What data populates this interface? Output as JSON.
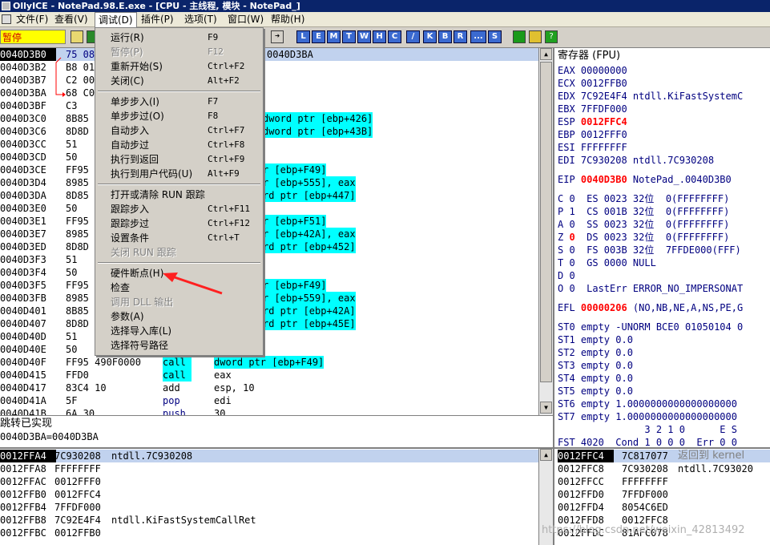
{
  "title": "OllyICE - NotePad.98.E.exe - [CPU - 主线程, 模块 - NotePad_]",
  "menu": [
    "文件(F)",
    "查看(V)",
    "调试(D)",
    "插件(P)",
    "选项(T)",
    "窗口(W)",
    "帮助(H)"
  ],
  "status": "暂停",
  "toolbar_letters": [
    "L",
    "E",
    "M",
    "T",
    "W",
    "H",
    "C",
    "/",
    "K",
    "B",
    "R",
    "...",
    "S"
  ],
  "disasm": {
    "header_addr": "0040D3BA",
    "rows": [
      {
        "addr": "0040D3B0",
        "hex": "75 08",
        "mnem": "",
        "arg": ""
      },
      {
        "addr": "0040D3B2",
        "hex": "B8 01",
        "mnem": "",
        "arg": ""
      },
      {
        "addr": "0040D3B7",
        "hex": "C2 00",
        "mnem": "",
        "arg": ""
      },
      {
        "addr": "0040D3BA",
        "hex": "68 C0",
        "mnem": "",
        "arg": ""
      },
      {
        "addr": "0040D3BF",
        "hex": "C3",
        "mnem": "",
        "arg": ""
      },
      {
        "addr": "0040D3C0",
        "hex": "8B85",
        "mnem": "",
        "arg": "dword ptr [ebp+426]"
      },
      {
        "addr": "0040D3C6",
        "hex": "8D8D",
        "mnem": "",
        "arg": "dword ptr [ebp+43B]"
      },
      {
        "addr": "0040D3CC",
        "hex": "51",
        "mnem": "",
        "arg": ""
      },
      {
        "addr": "0040D3CD",
        "hex": "50",
        "mnem": "",
        "arg": ""
      },
      {
        "addr": "0040D3CE",
        "hex": "FF95",
        "mnem": "",
        "arg": "r [ebp+F49]"
      },
      {
        "addr": "0040D3D4",
        "hex": "8985",
        "mnem": "",
        "arg": "r [ebp+555], eax"
      },
      {
        "addr": "0040D3DA",
        "hex": "8D85",
        "mnem": "",
        "arg": "rd ptr [ebp+447]"
      },
      {
        "addr": "0040D3E0",
        "hex": "50",
        "mnem": "",
        "arg": ""
      },
      {
        "addr": "0040D3E1",
        "hex": "FF95",
        "mnem": "",
        "arg": "r [ebp+F51]"
      },
      {
        "addr": "0040D3E7",
        "hex": "8985",
        "mnem": "",
        "arg": "r [ebp+42A], eax"
      },
      {
        "addr": "0040D3ED",
        "hex": "8D8D",
        "mnem": "",
        "arg": "rd ptr [ebp+452]"
      },
      {
        "addr": "0040D3F3",
        "hex": "51",
        "mnem": "",
        "arg": ""
      },
      {
        "addr": "0040D3F4",
        "hex": "50",
        "mnem": "",
        "arg": ""
      },
      {
        "addr": "0040D3F5",
        "hex": "FF95",
        "mnem": "",
        "arg": "r [ebp+F49]"
      },
      {
        "addr": "0040D3FB",
        "hex": "8985",
        "mnem": "",
        "arg": "r [ebp+559], eax"
      },
      {
        "addr": "0040D401",
        "hex": "8B85",
        "mnem": "",
        "arg": "rd ptr [ebp+42A]"
      },
      {
        "addr": "0040D407",
        "hex": "8D8D",
        "mnem": "",
        "arg": "rd ptr [ebp+45E]"
      },
      {
        "addr": "0040D40D",
        "hex": "51",
        "mnem": "",
        "arg": ""
      },
      {
        "addr": "0040D40E",
        "hex": "50",
        "mnem": "",
        "arg": ""
      },
      {
        "addr": "0040D40F",
        "hex": "FF95 490F0000",
        "mnem": "call",
        "arg": "dword ptr [ebp+F49]"
      },
      {
        "addr": "0040D415",
        "hex": "FFD0",
        "mnem": "call",
        "arg": "eax"
      },
      {
        "addr": "0040D417",
        "hex": "83C4 10",
        "mnem": "add",
        "arg": "esp, 10"
      },
      {
        "addr": "0040D41A",
        "hex": "5F",
        "mnem": "pop",
        "arg": "edi"
      },
      {
        "addr": "0040D41B",
        "hex": "6A 30",
        "mnem": "push",
        "arg": "30"
      }
    ]
  },
  "info": {
    "line1": "跳转已实现",
    "line2": "0040D3BA=0040D3BA"
  },
  "debug_menu": [
    {
      "label": "运行(R)",
      "shortcut": "F9",
      "disabled": false
    },
    {
      "label": "暂停(P)",
      "shortcut": "F12",
      "disabled": true
    },
    {
      "label": "重新开始(S)",
      "shortcut": "Ctrl+F2",
      "disabled": false
    },
    {
      "label": "关闭(C)",
      "shortcut": "Alt+F2",
      "disabled": false
    },
    {
      "sep": true
    },
    {
      "label": "单步步入(I)",
      "shortcut": "F7",
      "disabled": false
    },
    {
      "label": "单步步过(O)",
      "shortcut": "F8",
      "disabled": false
    },
    {
      "label": "自动步入",
      "shortcut": "Ctrl+F7",
      "disabled": false
    },
    {
      "label": "自动步过",
      "shortcut": "Ctrl+F8",
      "disabled": false
    },
    {
      "label": "执行到返回",
      "shortcut": "Ctrl+F9",
      "disabled": false
    },
    {
      "label": "执行到用户代码(U)",
      "shortcut": "Alt+F9",
      "disabled": false
    },
    {
      "sep": true
    },
    {
      "label": "打开或清除 RUN 跟踪",
      "shortcut": "",
      "disabled": false
    },
    {
      "label": "跟踪步入",
      "shortcut": "Ctrl+F11",
      "disabled": false
    },
    {
      "label": "跟踪步过",
      "shortcut": "Ctrl+F12",
      "disabled": false
    },
    {
      "label": "设置条件",
      "shortcut": "Ctrl+T",
      "disabled": false
    },
    {
      "label": "关闭 RUN 跟踪",
      "shortcut": "",
      "disabled": true
    },
    {
      "sep": true
    },
    {
      "label": "硬件断点(H)",
      "shortcut": "",
      "disabled": false
    },
    {
      "label": "检查",
      "shortcut": "",
      "disabled": false
    },
    {
      "label": "调用 DLL 输出",
      "shortcut": "",
      "disabled": true
    },
    {
      "label": "参数(A)",
      "shortcut": "",
      "disabled": false
    },
    {
      "label": "选择导入库(L)",
      "shortcut": "",
      "disabled": false
    },
    {
      "label": "选择符号路径",
      "shortcut": "",
      "disabled": false
    }
  ],
  "registers": {
    "header": "寄存器 (FPU)",
    "lines": [
      {
        "text": "EAX 00000000",
        "red": ""
      },
      {
        "text": "ECX 0012FFB0",
        "red": ""
      },
      {
        "text": "EDX 7C92E4F4 ntdll.KiFastSystemC",
        "red": ""
      },
      {
        "text": "EBX 7FFDF000",
        "red": ""
      },
      {
        "pre": "ESP ",
        "red": "0012FFC4",
        "post": ""
      },
      {
        "text": "EBP 0012FFF0",
        "red": ""
      },
      {
        "text": "ESI FFFFFFFF",
        "red": ""
      },
      {
        "text": "EDI 7C930208 ntdll.7C930208",
        "red": ""
      },
      {
        "gap": true
      },
      {
        "pre": "EIP ",
        "red": "0040D3B0",
        "post": " NotePad_.0040D3B0"
      },
      {
        "gap": true
      },
      {
        "text": "C 0  ES 0023 32位  0(FFFFFFFF)",
        "red": ""
      },
      {
        "text": "P 1  CS 001B 32位  0(FFFFFFFF)",
        "red": ""
      },
      {
        "text": "A 0  SS 0023 32位  0(FFFFFFFF)",
        "red": ""
      },
      {
        "pre": "Z ",
        "red": "0",
        "post": "  DS 0023 32位  0(FFFFFFFF)"
      },
      {
        "text": "S 0  FS 003B 32位  7FFDE000(FFF)",
        "red": ""
      },
      {
        "text": "T 0  GS 0000 NULL",
        "red": ""
      },
      {
        "text": "D 0",
        "red": ""
      },
      {
        "text": "O 0  LastErr ERROR_NO_IMPERSONAT",
        "red": ""
      },
      {
        "gap": true
      },
      {
        "pre": "EFL ",
        "red": "00000206",
        "post": " (NO,NB,NE,A,NS,PE,G"
      },
      {
        "gap": true
      },
      {
        "text": "ST0 empty -UNORM BCE0 01050104 0",
        "red": ""
      },
      {
        "text": "ST1 empty 0.0",
        "red": ""
      },
      {
        "text": "ST2 empty 0.0",
        "red": ""
      },
      {
        "text": "ST3 empty 0.0",
        "red": ""
      },
      {
        "text": "ST4 empty 0.0",
        "red": ""
      },
      {
        "text": "ST5 empty 0.0",
        "red": ""
      },
      {
        "text": "ST6 empty 1.0000000000000000000",
        "red": ""
      },
      {
        "text": "ST7 empty 1.0000000000000000000",
        "red": ""
      },
      {
        "text": "               3 2 1 0      E S",
        "red": ""
      },
      {
        "text": "FST 4020  Cond 1 0 0 0  Err 0 0",
        "red": ""
      }
    ]
  },
  "dump": {
    "rows": [
      {
        "addr": "0012FFA4",
        "val": "7C930208",
        "cmt": "ntdll.7C930208"
      },
      {
        "addr": "0012FFA8",
        "val": "FFFFFFFF",
        "cmt": ""
      },
      {
        "addr": "0012FFAC",
        "val": "0012FFF0",
        "cmt": ""
      },
      {
        "addr": "0012FFB0",
        "val": "0012FFC4",
        "cmt": ""
      },
      {
        "addr": "0012FFB4",
        "val": "7FFDF000",
        "cmt": ""
      },
      {
        "addr": "0012FFB8",
        "val": "7C92E4F4",
        "cmt": "ntdll.KiFastSystemCallRet"
      },
      {
        "addr": "0012FFBC",
        "val": "0012FFB0",
        "cmt": ""
      }
    ]
  },
  "stack": {
    "rows": [
      {
        "addr": "0012FFC4",
        "val": "7C817077",
        "cmt": "返回到 kernel"
      },
      {
        "addr": "0012FFC8",
        "val": "7C930208",
        "cmt": "ntdll.7C93020"
      },
      {
        "addr": "0012FFCC",
        "val": "FFFFFFFF",
        "cmt": ""
      },
      {
        "addr": "0012FFD0",
        "val": "7FFDF000",
        "cmt": ""
      },
      {
        "addr": "0012FFD4",
        "val": "8054C6ED",
        "cmt": ""
      },
      {
        "addr": "0012FFD8",
        "val": "0012FFC8",
        "cmt": ""
      },
      {
        "addr": "0012FFDC",
        "val": "81AFC078",
        "cmt": ""
      }
    ]
  },
  "watermark": "https://blog.csdn.net/weixin_42813492",
  "colors": {
    "cyan": "#00ffff",
    "red": "#ff0000",
    "title": "#0a246a",
    "status_bg": "#ffff00"
  }
}
